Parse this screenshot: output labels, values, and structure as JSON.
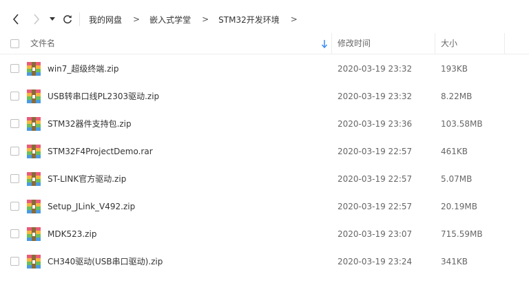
{
  "breadcrumb": [
    "我的网盘",
    "嵌入式学堂",
    "STM32开发环境"
  ],
  "breadcrumb_separator": ">",
  "columns": {
    "name": "文件名",
    "mtime": "修改时间",
    "size": "大小"
  },
  "files": [
    {
      "name": "win7_超级终端.zip",
      "mtime": "2020-03-19 23:32",
      "size": "193KB"
    },
    {
      "name": "USB转串口线PL2303驱动.zip",
      "mtime": "2020-03-19 23:32",
      "size": "8.22MB"
    },
    {
      "name": "STM32器件支持包.zip",
      "mtime": "2020-03-19 23:36",
      "size": "103.58MB"
    },
    {
      "name": "STM32F4ProjectDemo.rar",
      "mtime": "2020-03-19 22:57",
      "size": "461KB"
    },
    {
      "name": "ST-LINK官方驱动.zip",
      "mtime": "2020-03-19 22:57",
      "size": "5.07MB"
    },
    {
      "name": "Setup_JLink_V492.zip",
      "mtime": "2020-03-19 22:57",
      "size": "20.19MB"
    },
    {
      "name": "MDK523.zip",
      "mtime": "2020-03-19 23:07",
      "size": "715.59MB"
    },
    {
      "name": "CH340驱动(USB串口驱动).zip",
      "mtime": "2020-03-19 23:24",
      "size": "341KB"
    }
  ],
  "icons": {
    "back": "chevron-left-icon",
    "forward": "chevron-right-icon",
    "history": "caret-down-icon",
    "refresh": "refresh-icon",
    "sort": "arrow-down-icon",
    "file": "archive-file-icon"
  },
  "colors": {
    "sort_arrow": "#3b8cf5",
    "disabled_nav": "#c8c8c8"
  }
}
